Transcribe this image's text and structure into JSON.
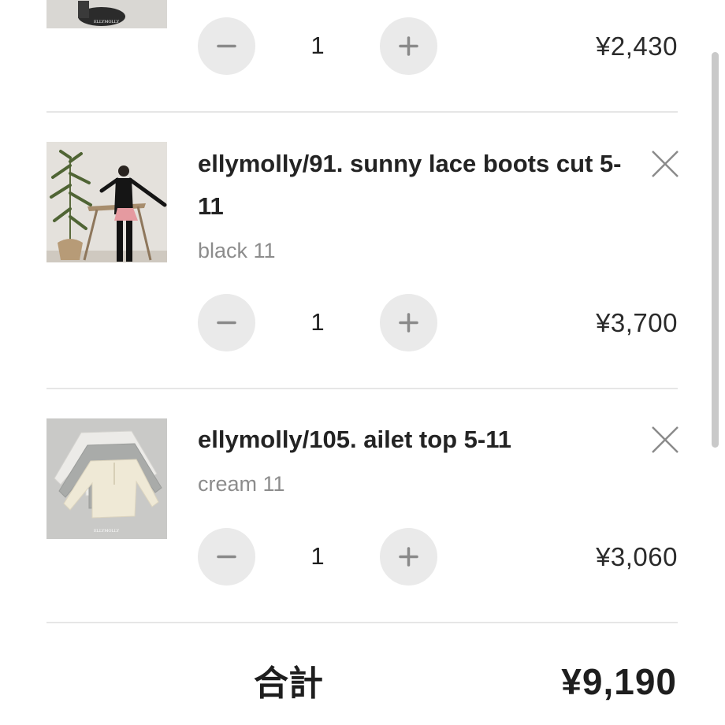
{
  "cart": {
    "items": [
      {
        "title": "",
        "variant": "",
        "quantity": "1",
        "price": "¥2,430",
        "image_caption": "ELLYMOLLY"
      },
      {
        "title": "ellymolly/91. sunny lace boots cut 5-11",
        "variant": "black 11",
        "quantity": "1",
        "price": "¥3,700",
        "image_caption": ""
      },
      {
        "title": "ellymolly/105. ailet top 5-11",
        "variant": "cream 11",
        "quantity": "1",
        "price": "¥3,060",
        "image_caption": "ELLYMOLLY"
      }
    ],
    "total_label": "合計",
    "total_value": "¥9,190"
  },
  "icons": {
    "decrement": "minus-icon",
    "increment": "plus-icon",
    "remove": "close-icon"
  },
  "colors": {
    "button_bg": "#eaeaea",
    "icon": "#8a8a8a",
    "divider": "#e6e6e6",
    "text": "#222222",
    "variant_text": "#8c8c8c"
  }
}
